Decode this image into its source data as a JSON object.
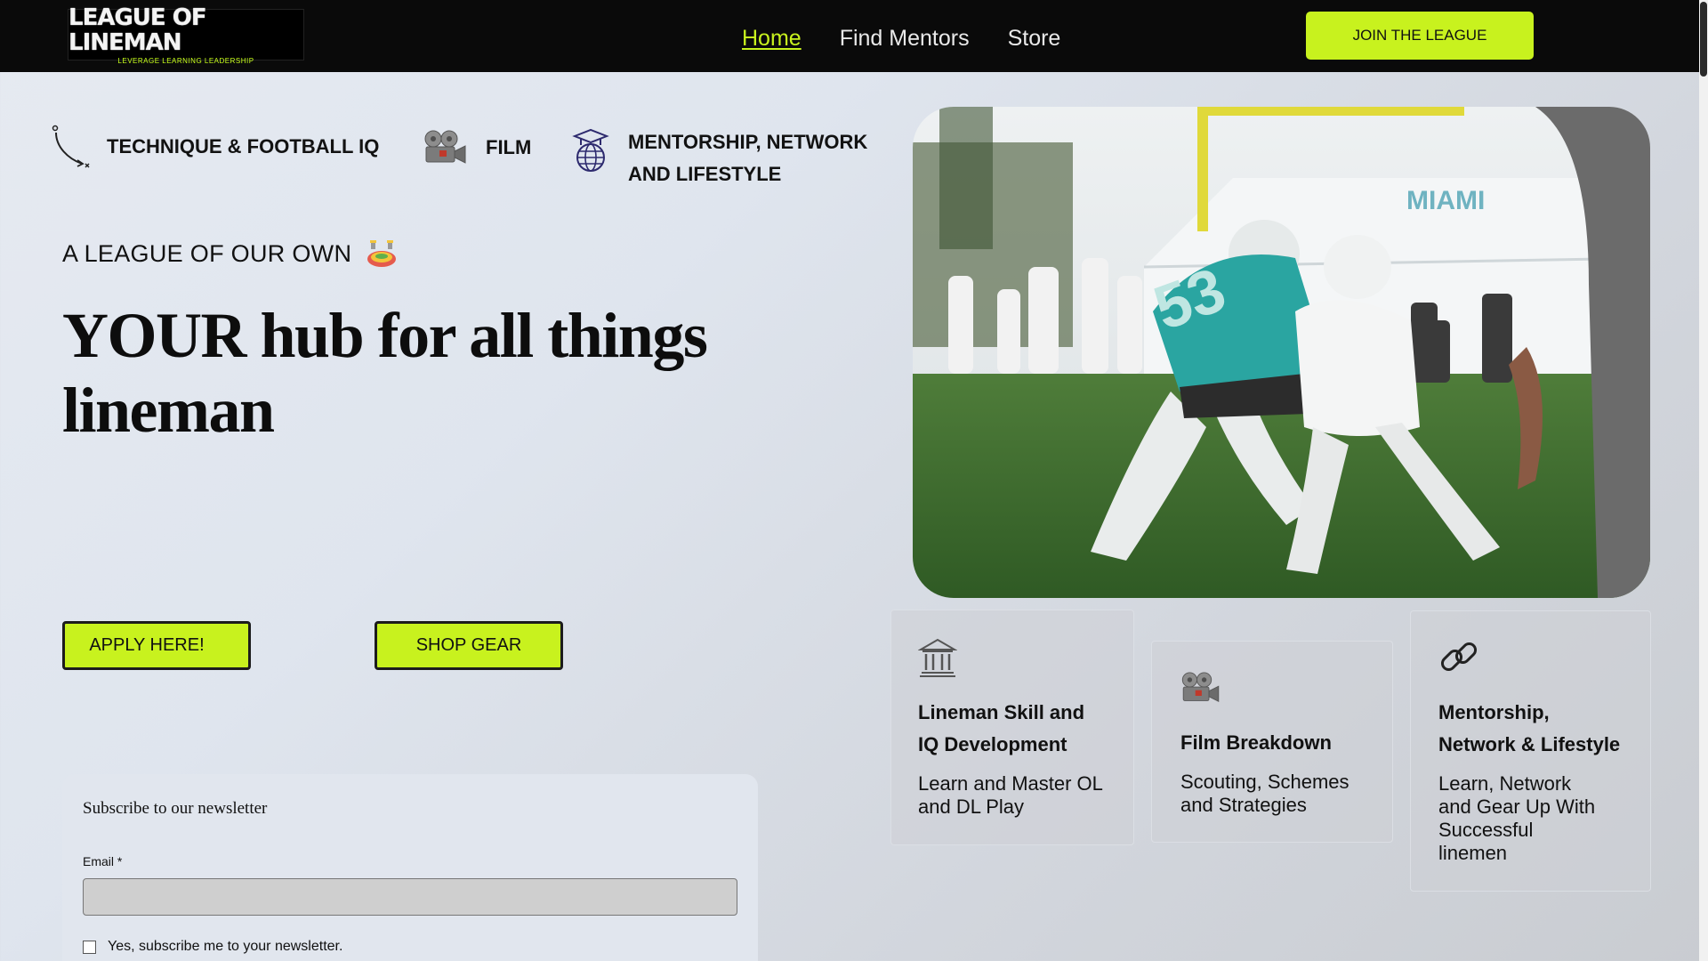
{
  "header": {
    "logo_text": "LEAGUE OF LINEMAN",
    "logo_subtext": "LEVERAGE  LEARNING  LEADERSHIP",
    "nav": [
      {
        "label": "Home",
        "active": true
      },
      {
        "label": "Find Mentors",
        "active": false
      },
      {
        "label": "Store",
        "active": false
      }
    ],
    "cta_label": "JOIN THE LEAGUE"
  },
  "features": [
    {
      "label": "TECHNIQUE & FOOTBALL IQ",
      "icon": "play-diagram-icon"
    },
    {
      "label": "FILM",
      "icon": "film-camera-icon"
    },
    {
      "label_line1": "MENTORSHIP, NETWORK",
      "label_line2": "AND LIFESTYLE",
      "icon": "graduation-globe-icon"
    }
  ],
  "hero": {
    "tagline": "A LEAGUE OF OUR OWN",
    "tagline_icon": "stadium-icon",
    "headline_line1": "YOUR hub for all things",
    "headline_line2": "lineman",
    "apply_label": "APPLY HERE!",
    "shop_label": "SHOP GEAR"
  },
  "newsletter": {
    "title": "Subscribe to our newsletter",
    "email_label": "Email *",
    "email_value": "",
    "checkbox_label": "Yes, subscribe me to your newsletter."
  },
  "cards": [
    {
      "icon": "museum-icon",
      "title_line1": "Lineman Skill and",
      "title_line2": "IQ Development",
      "text_line1": "Learn and Master OL",
      "text_line2": "and DL Play"
    },
    {
      "icon": "film-camera-icon",
      "title": "Film Breakdown",
      "text_line1": "Scouting, Schemes",
      "text_line2": "and Strategies"
    },
    {
      "icon": "link-icon",
      "title_line1": "Mentorship,",
      "title_line2": "Network & Lifestyle",
      "text_line1": "Learn, Network",
      "text_line2": "and Gear Up With",
      "text_line3": "Successful",
      "text_line4": "linemen"
    }
  ],
  "colors": {
    "accent": "#c8f21e",
    "header_bg": "#0a0a0a"
  }
}
